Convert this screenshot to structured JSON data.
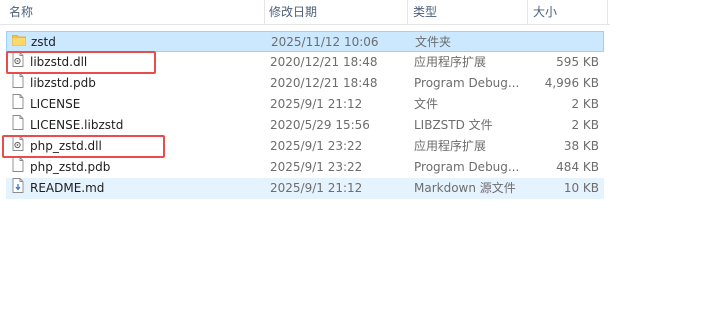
{
  "columns": {
    "name": "名称",
    "date": "修改日期",
    "type": "类型",
    "size": "大小",
    "sort_indicator": "^"
  },
  "files": [
    {
      "name": "zstd",
      "date": "2025/11/12 10:06",
      "type": "文件夹",
      "size": "",
      "icon": "folder-icon",
      "state": "selected"
    },
    {
      "name": "libzstd.dll",
      "date": "2020/12/21 18:48",
      "type": "应用程序扩展",
      "size": "595 KB",
      "icon": "dll-file-icon",
      "state": "normal"
    },
    {
      "name": "libzstd.pdb",
      "date": "2020/12/21 18:48",
      "type": "Program Debug...",
      "size": "4,996 KB",
      "icon": "file-icon",
      "state": "normal"
    },
    {
      "name": "LICENSE",
      "date": "2025/9/1 21:12",
      "type": "文件",
      "size": "2 KB",
      "icon": "file-icon",
      "state": "normal"
    },
    {
      "name": "LICENSE.libzstd",
      "date": "2020/5/29 15:56",
      "type": "LIBZSTD 文件",
      "size": "2 KB",
      "icon": "file-icon",
      "state": "normal"
    },
    {
      "name": "php_zstd.dll",
      "date": "2025/9/1 23:22",
      "type": "应用程序扩展",
      "size": "38 KB",
      "icon": "dll-file-icon",
      "state": "normal"
    },
    {
      "name": "php_zstd.pdb",
      "date": "2025/9/1 23:22",
      "type": "Program Debug...",
      "size": "484 KB",
      "icon": "file-icon",
      "state": "normal"
    },
    {
      "name": "README.md",
      "date": "2025/9/1 21:12",
      "type": "Markdown 源文件",
      "size": "10 KB",
      "icon": "markdown-file-icon",
      "state": "hover"
    }
  ],
  "colors": {
    "selection": "#cce8ff",
    "hover": "#e5f3ff",
    "callout": "#e84c4c",
    "folder": "#f4c14b"
  }
}
